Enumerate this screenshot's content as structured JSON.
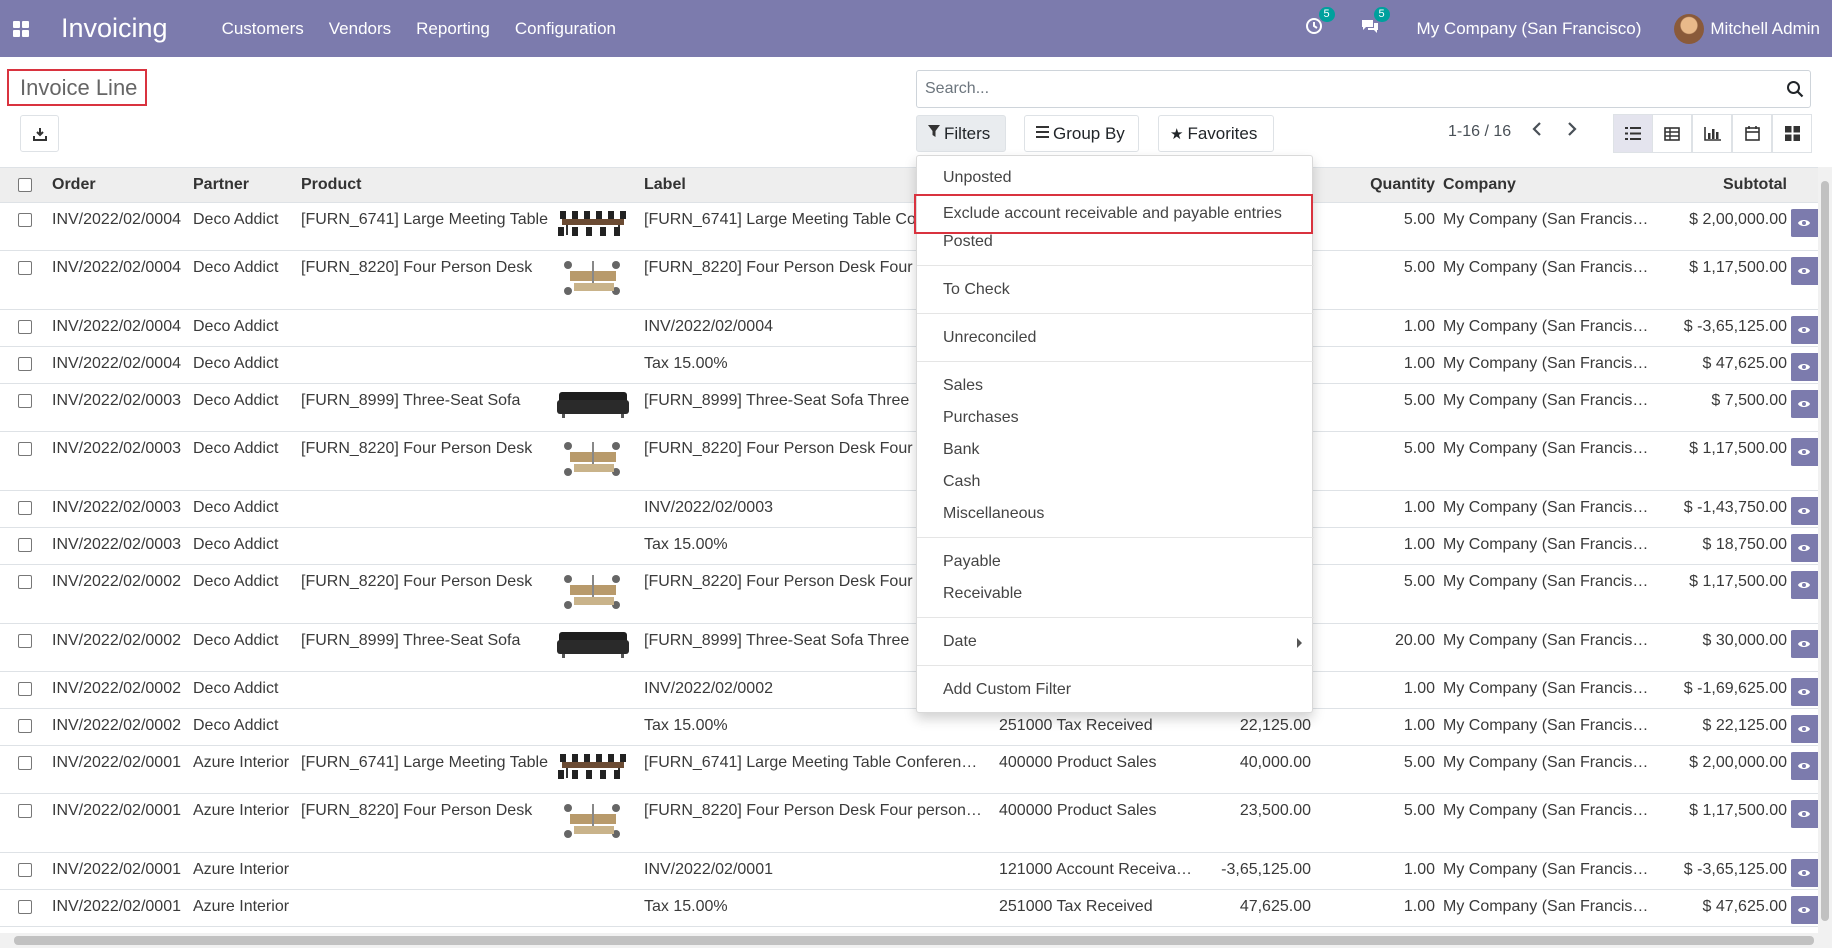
{
  "navbar": {
    "app_name": "Invoicing",
    "menu": [
      "Customers",
      "Vendors",
      "Reporting",
      "Configuration"
    ],
    "activity_count": "5",
    "messages_count": "5",
    "company": "My Company (San Francisco)",
    "user": "Mitchell Admin"
  },
  "breadcrumb": {
    "title": "Invoice Line"
  },
  "search": {
    "placeholder": "Search..."
  },
  "buttons": {
    "filters": "Filters",
    "group_by": "Group By",
    "favorites": "Favorites"
  },
  "pager": {
    "value": "1-16 / 16"
  },
  "columns": {
    "order": "Order",
    "partner": "Partner",
    "product": "Product",
    "label": "Label",
    "quantity": "Quantity",
    "company": "Company",
    "subtotal": "Subtotal"
  },
  "rows": [
    {
      "order": "INV/2022/02/0004",
      "partner": "Deco Addict",
      "product": "[FURN_6741] Large Meeting Table",
      "thumb": "meeting-table",
      "label": "[FURN_6741] Large Meeting Table Co",
      "account": "",
      "price": "",
      "quantity": "5.00",
      "company": "My Company (San Francis…",
      "subtotal": "$ 2,00,000.00",
      "size": "med"
    },
    {
      "order": "INV/2022/02/0004",
      "partner": "Deco Addict",
      "product": "[FURN_8220] Four Person Desk",
      "thumb": "desk",
      "label": "[FURN_8220] Four Person Desk Four",
      "account": "",
      "price": "",
      "quantity": "5.00",
      "company": "My Company (San Francis…",
      "subtotal": "$ 1,17,500.00",
      "size": "tall"
    },
    {
      "order": "INV/2022/02/0004",
      "partner": "Deco Addict",
      "product": "",
      "thumb": "",
      "label": "INV/2022/02/0004",
      "account": "",
      "price": "",
      "quantity": "1.00",
      "company": "My Company (San Francis…",
      "subtotal": "$ -3,65,125.00",
      "size": "short"
    },
    {
      "order": "INV/2022/02/0004",
      "partner": "Deco Addict",
      "product": "",
      "thumb": "",
      "label": "Tax 15.00%",
      "account": "",
      "price": "",
      "quantity": "1.00",
      "company": "My Company (San Francis…",
      "subtotal": "$ 47,625.00",
      "size": "short"
    },
    {
      "order": "INV/2022/02/0003",
      "partner": "Deco Addict",
      "product": "[FURN_8999] Three-Seat Sofa",
      "thumb": "sofa",
      "label": "[FURN_8999] Three-Seat Sofa Three",
      "account": "",
      "price": "",
      "quantity": "5.00",
      "company": "My Company (San Francis…",
      "subtotal": "$ 7,500.00",
      "size": "med"
    },
    {
      "order": "INV/2022/02/0003",
      "partner": "Deco Addict",
      "product": "[FURN_8220] Four Person Desk",
      "thumb": "desk",
      "label": "[FURN_8220] Four Person Desk Four",
      "account": "",
      "price": "",
      "quantity": "5.00",
      "company": "My Company (San Francis…",
      "subtotal": "$ 1,17,500.00",
      "size": "tall"
    },
    {
      "order": "INV/2022/02/0003",
      "partner": "Deco Addict",
      "product": "",
      "thumb": "",
      "label": "INV/2022/02/0003",
      "account": "",
      "price": "",
      "quantity": "1.00",
      "company": "My Company (San Francis…",
      "subtotal": "$ -1,43,750.00",
      "size": "short"
    },
    {
      "order": "INV/2022/02/0003",
      "partner": "Deco Addict",
      "product": "",
      "thumb": "",
      "label": "Tax 15.00%",
      "account": "",
      "price": "",
      "quantity": "1.00",
      "company": "My Company (San Francis…",
      "subtotal": "$ 18,750.00",
      "size": "short"
    },
    {
      "order": "INV/2022/02/0002",
      "partner": "Deco Addict",
      "product": "[FURN_8220] Four Person Desk",
      "thumb": "desk",
      "label": "[FURN_8220] Four Person Desk Four",
      "account": "",
      "price": "",
      "quantity": "5.00",
      "company": "My Company (San Francis…",
      "subtotal": "$ 1,17,500.00",
      "size": "tall"
    },
    {
      "order": "INV/2022/02/0002",
      "partner": "Deco Addict",
      "product": "[FURN_8999] Three-Seat Sofa",
      "thumb": "sofa",
      "label": "[FURN_8999] Three-Seat Sofa Three",
      "account": "",
      "price": "",
      "quantity": "20.00",
      "company": "My Company (San Francis…",
      "subtotal": "$ 30,000.00",
      "size": "med"
    },
    {
      "order": "INV/2022/02/0002",
      "partner": "Deco Addict",
      "product": "",
      "thumb": "",
      "label": "INV/2022/02/0002",
      "account": "",
      "price": "",
      "quantity": "1.00",
      "company": "My Company (San Francis…",
      "subtotal": "$ -1,69,625.00",
      "size": "short"
    },
    {
      "order": "INV/2022/02/0002",
      "partner": "Deco Addict",
      "product": "",
      "thumb": "",
      "label": "Tax 15.00%",
      "account": "251000 Tax Received",
      "price": "22,125.00",
      "quantity": "1.00",
      "company": "My Company (San Francis…",
      "subtotal": "$ 22,125.00",
      "size": "short"
    },
    {
      "order": "INV/2022/02/0001",
      "partner": "Azure Interior",
      "product": "[FURN_6741] Large Meeting Table",
      "thumb": "meeting-table",
      "label": "[FURN_6741] Large Meeting Table Conferen…",
      "account": "400000 Product Sales",
      "price": "40,000.00",
      "quantity": "5.00",
      "company": "My Company (San Francis…",
      "subtotal": "$ 2,00,000.00",
      "size": "med"
    },
    {
      "order": "INV/2022/02/0001",
      "partner": "Azure Interior",
      "product": "[FURN_8220] Four Person Desk",
      "thumb": "desk",
      "label": "[FURN_8220] Four Person Desk Four person…",
      "account": "400000 Product Sales",
      "price": "23,500.00",
      "quantity": "5.00",
      "company": "My Company (San Francis…",
      "subtotal": "$ 1,17,500.00",
      "size": "tall"
    },
    {
      "order": "INV/2022/02/0001",
      "partner": "Azure Interior",
      "product": "",
      "thumb": "",
      "label": "INV/2022/02/0001",
      "account": "121000 Account Receiva…",
      "price": "-3,65,125.00",
      "quantity": "1.00",
      "company": "My Company (San Francis…",
      "subtotal": "$ -3,65,125.00",
      "size": "short"
    },
    {
      "order": "INV/2022/02/0001",
      "partner": "Azure Interior",
      "product": "",
      "thumb": "",
      "label": "Tax 15.00%",
      "account": "251000 Tax Received",
      "price": "47,625.00",
      "quantity": "1.00",
      "company": "My Company (San Francis…",
      "subtotal": "$ 47,625.00",
      "size": "short"
    }
  ],
  "filters_dropdown": {
    "items": [
      {
        "label": "Unposted"
      },
      {
        "label": "Exclude account receivable and payable entries",
        "highlighted": true
      },
      {
        "label": "Posted"
      },
      {
        "label": "To Check"
      },
      {
        "label": "Unreconciled"
      },
      {
        "label": "Sales"
      },
      {
        "label": "Purchases"
      },
      {
        "label": "Bank"
      },
      {
        "label": "Cash"
      },
      {
        "label": "Miscellaneous"
      },
      {
        "label": "Payable"
      },
      {
        "label": "Receivable"
      },
      {
        "label": "Date",
        "submenu": true
      },
      {
        "label": "Add Custom Filter"
      }
    ]
  },
  "colors": {
    "navbar": "#7c7bad",
    "highlight_border": "#d9333f",
    "badge": "#00a09d"
  }
}
